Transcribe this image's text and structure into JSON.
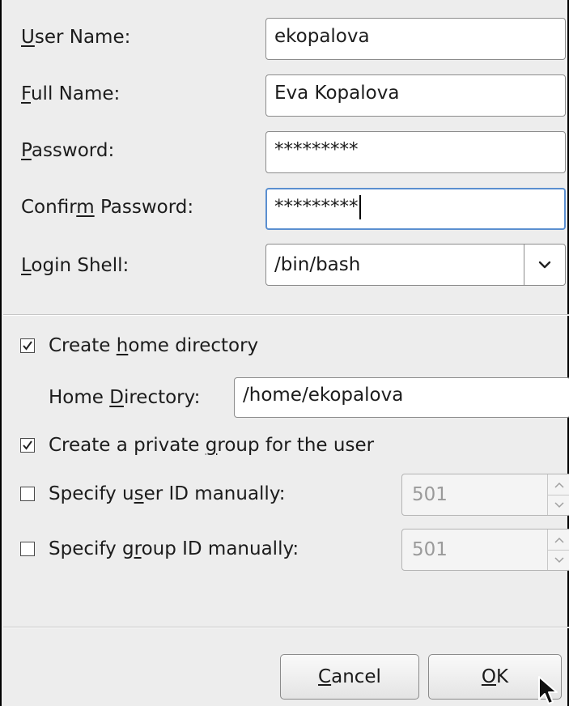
{
  "form": {
    "user_name": {
      "label_mnemonic": "U",
      "label_rest": "ser Name:",
      "value": "ekopalova"
    },
    "full_name": {
      "label_mnemonic": "F",
      "label_rest": "ull Name:",
      "value": "Eva Kopalova"
    },
    "password": {
      "label_mnemonic": "P",
      "label_rest": "assword:",
      "value": "*********"
    },
    "confirm_password": {
      "label_pre": "Confir",
      "label_mnemonic": "m",
      "label_rest": " Password:",
      "value": "*********"
    },
    "login_shell": {
      "label_mnemonic": "L",
      "label_rest": "ogin Shell:",
      "value": "/bin/bash",
      "icon": "chevron-down-icon"
    }
  },
  "options": {
    "create_home": {
      "label_pre": "Create ",
      "label_mnemonic": "h",
      "label_rest": "ome directory",
      "checked": true
    },
    "home_directory": {
      "label_pre": "Home ",
      "label_mnemonic": "D",
      "label_rest": "irectory:",
      "value": "/home/ekopalova"
    },
    "private_group": {
      "label_pre": "Create a private ",
      "label_mnemonic": "g",
      "label_rest": "roup for the user",
      "checked": true
    },
    "user_id": {
      "label_pre": "Specify u",
      "label_mnemonic": "s",
      "label_rest": "er ID manually:",
      "checked": false,
      "value": "501"
    },
    "group_id": {
      "label_pre": "Specify g",
      "label_mnemonic": "r",
      "label_rest": "oup ID manually:",
      "checked": false,
      "value": "501"
    }
  },
  "buttons": {
    "cancel": {
      "mnemonic": "C",
      "rest": "ancel"
    },
    "ok": {
      "mnemonic": "O",
      "rest": "K"
    }
  },
  "colors": {
    "focus_border": "#5b8fd0",
    "dialog_background": "#ededed"
  }
}
